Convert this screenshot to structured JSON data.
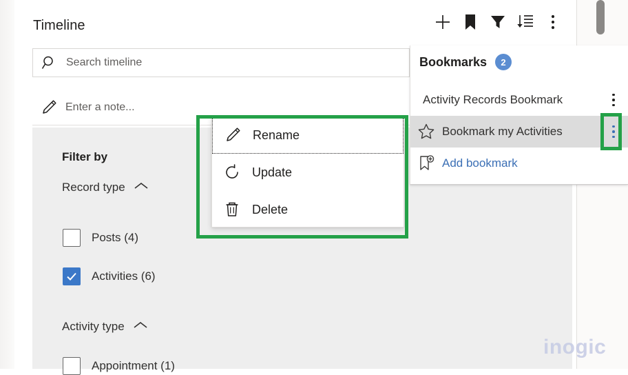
{
  "header": {
    "title": "Timeline",
    "actions": [
      {
        "name": "add",
        "icon": "plus-icon",
        "label": "Add"
      },
      {
        "name": "bookmarks",
        "icon": "bookmark-filled-icon",
        "label": "Bookmarks"
      },
      {
        "name": "filter",
        "icon": "funnel-icon",
        "label": "Filter"
      },
      {
        "name": "sort",
        "icon": "sort-descending-icon",
        "label": "Sort"
      },
      {
        "name": "more",
        "icon": "more-vertical-icon",
        "label": "More commands"
      }
    ]
  },
  "search": {
    "placeholder": "Search timeline",
    "value": "",
    "icon": "search-icon"
  },
  "note": {
    "placeholder": "Enter a note...",
    "icon": "pencil-icon"
  },
  "filter": {
    "title": "Filter by",
    "groups": [
      {
        "label": "Record type",
        "expanded": true,
        "chevron": "chevron-up-icon",
        "options": [
          {
            "label": "Posts (4)",
            "checked": false
          },
          {
            "label": "Activities (6)",
            "checked": true
          }
        ]
      },
      {
        "label": "Activity type",
        "expanded": true,
        "chevron": "chevron-up-icon",
        "options": [
          {
            "label": "Appointment (1)",
            "checked": false
          }
        ]
      }
    ]
  },
  "bookmarks": {
    "title": "Bookmarks",
    "count": "2",
    "items": [
      {
        "label": "Activity Records Bookmark",
        "icon": "",
        "selected": false,
        "kebab": "more-vertical-icon"
      },
      {
        "label": "Bookmark my Activities",
        "icon": "star-outline-icon",
        "selected": true,
        "kebab": "more-vertical-icon"
      }
    ],
    "add": {
      "label": "Add bookmark",
      "icon": "bookmark-add-icon"
    }
  },
  "context_menu": {
    "items": [
      {
        "label": "Rename",
        "icon": "pencil-icon",
        "focused": true
      },
      {
        "label": "Update",
        "icon": "refresh-icon",
        "focused": false
      },
      {
        "label": "Delete",
        "icon": "trash-icon",
        "focused": false
      }
    ]
  },
  "annotations": {
    "highlight_color": "#24a148",
    "boxes": [
      {
        "name": "context-menu-highlight"
      },
      {
        "name": "kebab-highlight"
      }
    ]
  },
  "watermark": {
    "text": "inogic",
    "color": "#c6cbe4"
  },
  "scrollbar": {
    "position": "top"
  }
}
